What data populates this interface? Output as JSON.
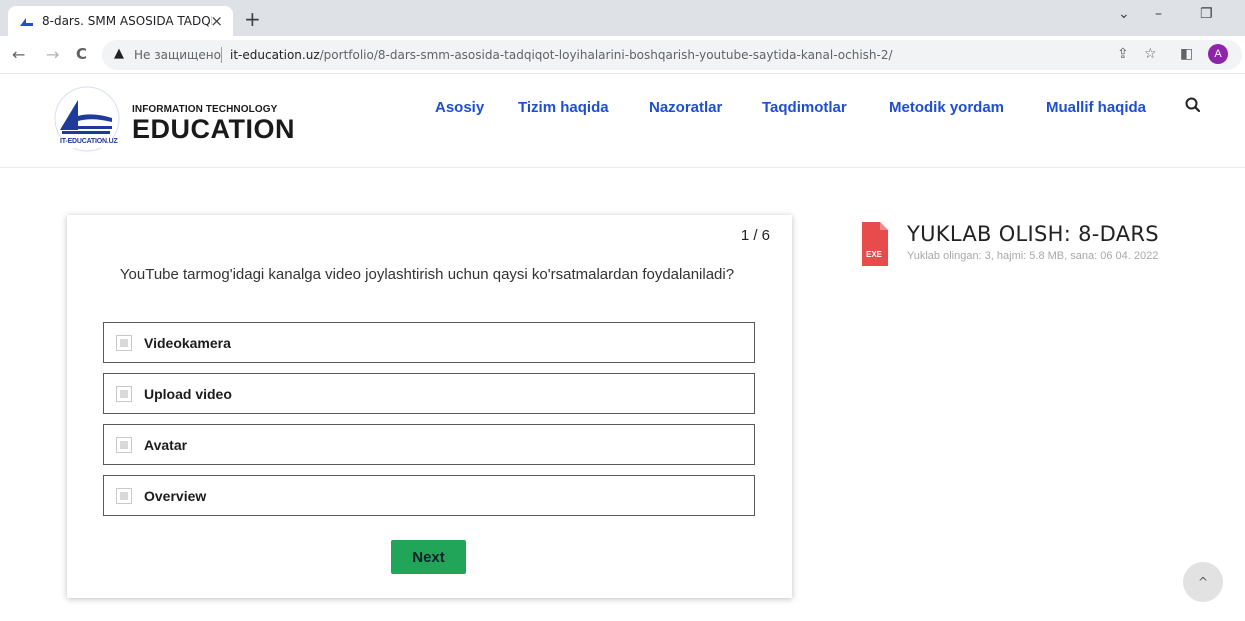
{
  "browser": {
    "tab_title": "8-dars. SMM ASOSIDA TADQIQOT",
    "new_tab": "+",
    "close_tab": "×",
    "window_controls": {
      "dropdown": "⌄",
      "minimize": "–",
      "restore": "❐"
    },
    "nav": {
      "back": "←",
      "forward": "→",
      "reload": "C"
    },
    "omnibox": {
      "warning_icon": "▲",
      "insecure_label": "Не защищено",
      "host": "it-education.uz",
      "path": "/portfolio/8-dars-smm-asosida-tadqiqot-loyihalarini-boshqarish-youtube-saytida-kanal-ochish-2/"
    },
    "toolbar_icons": {
      "share": "⇪",
      "bookmark": "☆",
      "side_panel": "◧"
    },
    "profile_initial": "A"
  },
  "site": {
    "logo": {
      "badge_text": "IT-EDUCATION.UZ",
      "subtitle": "INFORMATION TECHNOLOGY",
      "title": "EDUCATION"
    },
    "nav": [
      "Asosiy",
      "Tizim haqida",
      "Nazoratlar",
      "Taqdimotlar",
      "Metodik yordam",
      "Muallif haqida"
    ],
    "search_icon": "search-icon"
  },
  "quiz": {
    "progress": "1 / 6",
    "question": "YouTube tarmog'idagi kanalga video joylashtirish uchun qaysi ko'rsatmalardan foydalaniladi?",
    "options": [
      "Videokamera",
      "Upload video",
      "Avatar",
      "Overview"
    ],
    "next_label": "Next"
  },
  "download": {
    "file_type": "EXE",
    "title": "YUKLAB OLISH: 8-DARS",
    "meta": "Yuklab olingan: 3, hajmi: 5.8 MB, sana: 06 04. 2022"
  },
  "scroll_top": "^",
  "colors": {
    "nav_link": "#1e4fd1",
    "next_button": "#21a558",
    "file_icon": "#e84b4b",
    "profile": "#8e24aa"
  }
}
